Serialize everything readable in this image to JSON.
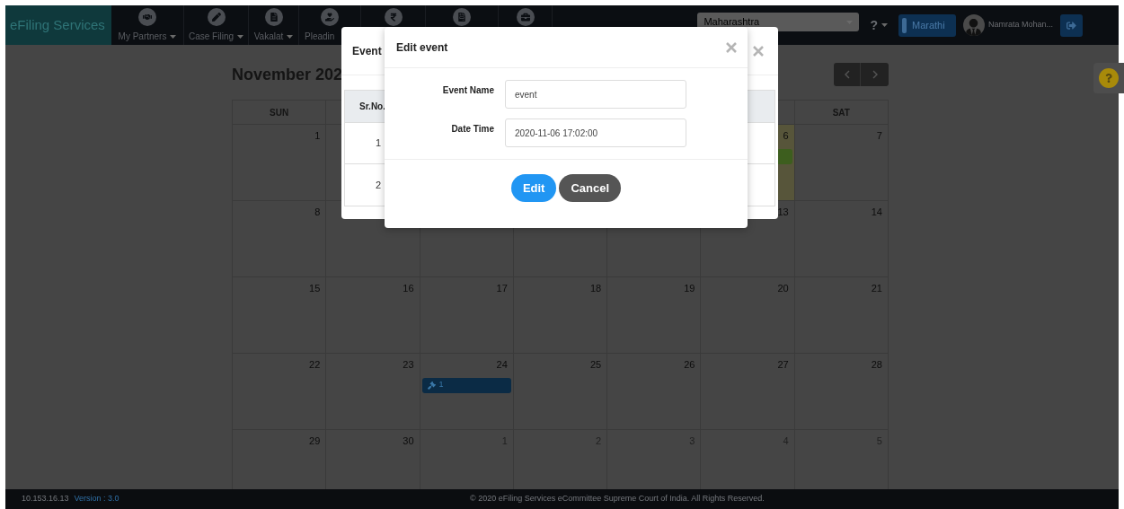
{
  "nav": {
    "brand": "eFiling Services",
    "items": [
      {
        "label": "My Partners",
        "dropdown": true
      },
      {
        "label": "Case Filing",
        "dropdown": true
      },
      {
        "label": "Vakalat",
        "dropdown": true
      },
      {
        "label": "Pleadin",
        "dropdown": false
      }
    ],
    "state_select": {
      "value": "Maharashtra"
    },
    "help_menu": {
      "label": "?"
    },
    "language_button": "Marathi",
    "user": {
      "name": "Namrata Mohan..."
    }
  },
  "calendar": {
    "title": "November 202",
    "headers": {
      "leading": [
        "SUN"
      ],
      "trailing": [
        "SAT"
      ]
    },
    "weeks": [
      {
        "leading": [
          {
            "day": "1",
            "muted": false,
            "today": false
          }
        ],
        "trailing": [
          {
            "day": "6",
            "muted": false,
            "today": true,
            "events": [
              {
                "color": "#3d5e1e"
              }
            ]
          },
          {
            "day": "7",
            "muted": false,
            "today": false
          }
        ]
      },
      {
        "leading": [
          {
            "day": "8",
            "muted": false,
            "today": false
          }
        ],
        "trailing": [
          {
            "day": "13",
            "muted": false,
            "today": false
          },
          {
            "day": "14",
            "muted": false,
            "today": false
          }
        ]
      },
      {
        "leading": [
          {
            "day": "15",
            "muted": false,
            "today": false
          },
          {
            "day": "16",
            "muted": false,
            "today": false
          },
          {
            "day": "17",
            "muted": false,
            "today": false
          },
          {
            "day": "18",
            "muted": false,
            "today": false
          },
          {
            "day": "19",
            "muted": false,
            "today": false
          },
          {
            "day": "20",
            "muted": false,
            "today": false
          },
          {
            "day": "21",
            "muted": false,
            "today": false
          }
        ]
      },
      {
        "leading": [
          {
            "day": "22",
            "muted": false,
            "today": false
          },
          {
            "day": "23",
            "muted": false,
            "today": false
          },
          {
            "day": "24",
            "muted": false,
            "today": false,
            "events": [
              {
                "color": "#0b2b45",
                "label": "1"
              }
            ]
          },
          {
            "day": "25",
            "muted": false,
            "today": false
          },
          {
            "day": "26",
            "muted": false,
            "today": false
          },
          {
            "day": "27",
            "muted": false,
            "today": false
          },
          {
            "day": "28",
            "muted": false,
            "today": false
          }
        ]
      },
      {
        "leading": [
          {
            "day": "29",
            "muted": false,
            "today": false
          },
          {
            "day": "30",
            "muted": false,
            "today": false
          },
          {
            "day": "1",
            "muted": true,
            "today": false
          },
          {
            "day": "2",
            "muted": true,
            "today": false
          },
          {
            "day": "3",
            "muted": true,
            "today": false
          },
          {
            "day": "4",
            "muted": true,
            "today": false
          },
          {
            "day": "5",
            "muted": true,
            "today": false
          }
        ]
      }
    ]
  },
  "events_modal": {
    "title": "Event",
    "table": {
      "columns": [
        "Sr.No."
      ],
      "rows": [
        [
          "1"
        ],
        [
          "2"
        ]
      ]
    }
  },
  "edit_modal": {
    "title": "Edit event",
    "fields": [
      {
        "label": "Event Name",
        "value": "event"
      },
      {
        "label": "Date Time",
        "value": "2020-11-06 17:02:00"
      }
    ],
    "buttons": [
      {
        "label": "Edit",
        "kind": "primary"
      },
      {
        "label": "Cancel",
        "kind": "secondary"
      }
    ]
  },
  "footer": {
    "ip": "10.153.16.13",
    "version": "Version : 3.0",
    "copyright": "© 2020 eFiling Services eCommittee Supreme Court of India. All Rights Reserved."
  }
}
